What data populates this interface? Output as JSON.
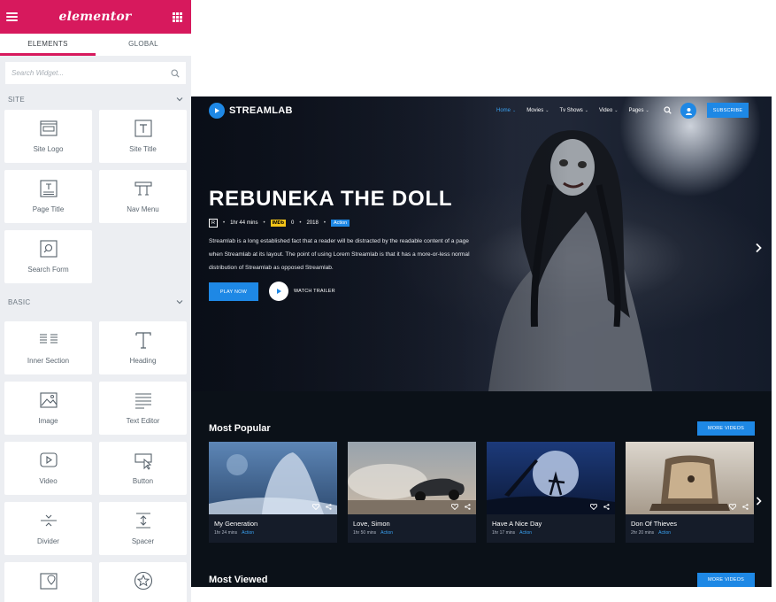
{
  "panel": {
    "logo": "elementor",
    "tabs": [
      "ELEMENTS",
      "GLOBAL"
    ],
    "search_placeholder": "Search Widget...",
    "sections": [
      {
        "title": "SITE",
        "widgets": [
          "Site Logo",
          "Site Title",
          "Page Title",
          "Nav Menu",
          "Search Form"
        ]
      },
      {
        "title": "BASIC",
        "widgets": [
          "Inner Section",
          "Heading",
          "Image",
          "Text Editor",
          "Video",
          "Button",
          "Divider",
          "Spacer",
          "",
          ""
        ]
      }
    ],
    "accent": "#d7195d"
  },
  "site": {
    "brand": "STREAMLAB",
    "nav": [
      {
        "label": "Home",
        "active": true
      },
      {
        "label": "Movies",
        "active": false
      },
      {
        "label": "Tv Shows",
        "active": false
      },
      {
        "label": "Video",
        "active": false
      },
      {
        "label": "Pages",
        "active": false
      }
    ],
    "subscribe": "SUBSCRIBE",
    "hero": {
      "title": "REBUNEKA THE DOLL",
      "rating": "R",
      "duration": "1hr 44 mins",
      "imdb_label": "IMDb",
      "imdb_score": "0",
      "year": "2018",
      "genre": "Action",
      "description": "Streamlab is a long established fact that a reader will be distracted by the readable content of a page when Streamlab at its layout. The point of using Lorem Streamlab is that it has a more-or-less normal distribution of Streamlab as opposed Streamlab.",
      "play": "PLAY NOW",
      "trailer": "WATCH TRAILER"
    },
    "most_popular": {
      "title": "Most Popular",
      "more": "MORE VIDEOS",
      "items": [
        {
          "name": "My Generation",
          "duration": "1hr 24 mins",
          "genre": "Action"
        },
        {
          "name": "Love, Simon",
          "duration": "1hr 50 mins",
          "genre": "Action"
        },
        {
          "name": "Have A Nice Day",
          "duration": "1hr 17 mins",
          "genre": "Action"
        },
        {
          "name": "Don Of Thieves",
          "duration": "2hr 20 mins",
          "genre": "Action"
        }
      ]
    },
    "most_viewed": {
      "title": "Most Viewed",
      "more": "MORE VIDEOS"
    },
    "accent": "#1e88e5"
  }
}
